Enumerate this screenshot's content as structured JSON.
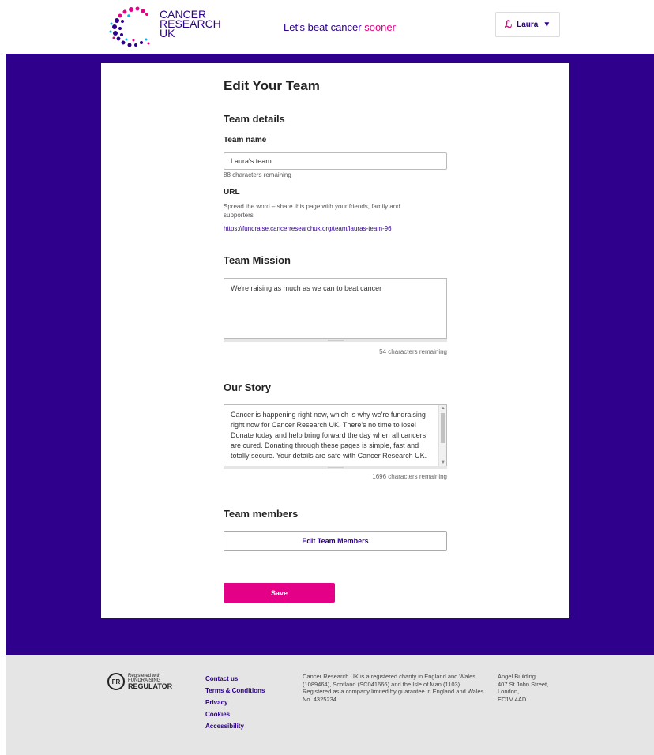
{
  "header": {
    "logo_line1": "CANCER",
    "logo_line2": "RESEARCH",
    "logo_line3": "UK",
    "tagline_main": "Let's beat cancer ",
    "tagline_accent": "sooner",
    "user_name": "Laura",
    "user_icon_glyph": "ℒ",
    "user_caret": "▼"
  },
  "page": {
    "title": "Edit Your Team",
    "team_details_heading": "Team details",
    "team_name_label": "Team name",
    "team_name_value": "Laura's team",
    "team_name_remaining": "88 characters remaining",
    "url_label": "URL",
    "url_help": "Spread the word – share this page with your friends, family and supporters",
    "url_value": "https://fundraise.cancerresearchuk.org/team/lauras-team-96",
    "mission_heading": "Team Mission",
    "mission_value": "We're raising as much as we can to beat cancer",
    "mission_remaining": "54 characters remaining",
    "story_heading": "Our Story",
    "story_value": "Cancer is happening right now, which is why we're fundraising right now for Cancer Research UK. There's no time to lose! Donate today and help bring forward the day when all cancers are cured. Donating through these pages is simple, fast and totally secure. Your details are safe with Cancer Research UK.",
    "story_remaining": "1696 characters remaining",
    "members_heading": "Team members",
    "edit_members_label": "Edit Team Members",
    "save_label": "Save"
  },
  "footer": {
    "fr_small": "Registered with",
    "fr_mid": "FUNDRAISING",
    "fr_big": "REGULATOR",
    "fr_badge": "FR",
    "links": [
      "Contact us",
      "Terms & Conditions",
      "Privacy",
      "Cookies",
      "Accessibility"
    ],
    "charity_text": "Cancer Research UK is a registered charity in England and Wales (1089464), Scotland (SC041666) and the Isle of Man (1103). Registered as a company limited by guarantee in England and Wales No. 4325234.",
    "address_lines": [
      "Angel Building",
      "407 St John Street,",
      "London,",
      "EC1V 4AD"
    ]
  },
  "colors": {
    "brand_purple": "#2e008b",
    "brand_pink": "#e40087",
    "footer_bg": "#e5e5e5"
  }
}
